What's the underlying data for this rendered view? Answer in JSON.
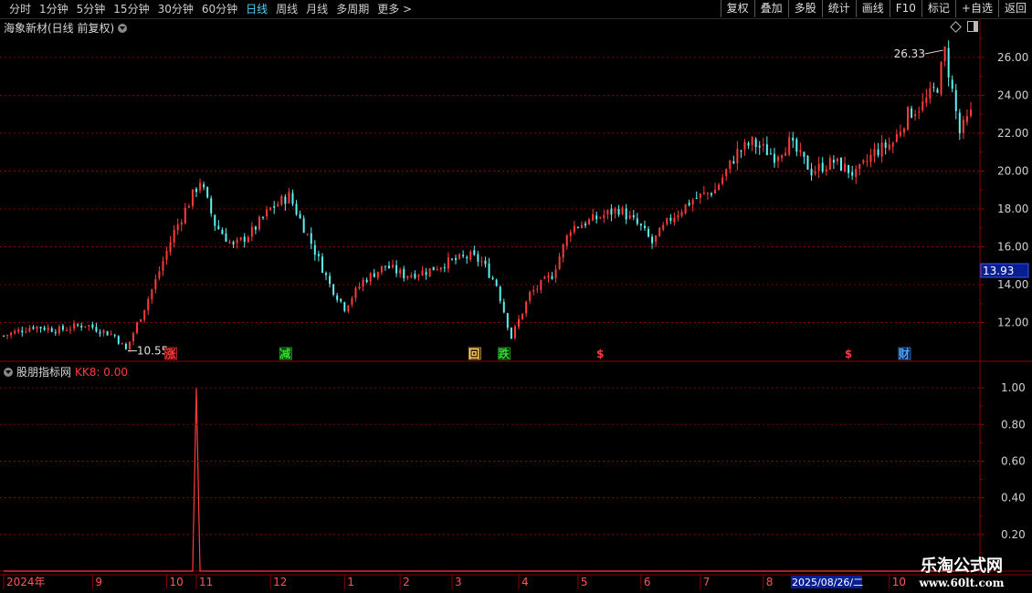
{
  "toolbar": {
    "periods": [
      "分时",
      "1分钟",
      "5分钟",
      "15分钟",
      "30分钟",
      "60分钟",
      "日线",
      "周线",
      "月线",
      "多周期",
      "更多 >"
    ],
    "active_period": "日线",
    "buttons": [
      "复权",
      "叠加",
      "多股",
      "统计",
      "画线",
      "F10",
      "标记",
      "+自选",
      "返回"
    ]
  },
  "main_panel": {
    "title": "海象新材(日线 前复权)",
    "current_price": "13.93",
    "high_label": "26.33",
    "low_label": "10.55",
    "markers": [
      {
        "day": 45,
        "text": "涨",
        "color": "#ff3b3b",
        "bg": "#3a0000"
      },
      {
        "day": 76,
        "text": "减",
        "color": "#33dd33",
        "bg": "#003300"
      },
      {
        "day": 127,
        "text": "回",
        "color": "#ffcc66",
        "bg": "#332200"
      },
      {
        "day": 135,
        "text": "跌",
        "color": "#33dd33",
        "bg": "#002200"
      },
      {
        "day": 161,
        "text": "$",
        "color": "#ff3b3b",
        "bg": ""
      },
      {
        "day": 228,
        "text": "$",
        "color": "#ff3b3b",
        "bg": ""
      },
      {
        "day": 243,
        "text": "财",
        "color": "#4fa8ff",
        "bg": "#001a40"
      }
    ]
  },
  "indicator_panel": {
    "name": "股朋指标网",
    "value_text": "KK8: 0.00"
  },
  "time_axis": {
    "labels": [
      "2024年",
      "9",
      "10",
      "11",
      "12",
      "1",
      "2",
      "3",
      "4",
      "5",
      "6",
      "7",
      "8",
      "10"
    ],
    "cursor_date": "2025/08/26/二"
  },
  "colors": {
    "up": "#ff3b3b",
    "down": "#5ff2f2",
    "grid": "#8b0000",
    "axis": "#8b0000",
    "price_box": "#0a1f8f"
  },
  "chart_data": [
    {
      "type": "candlestick",
      "title": "海象新材(日线 前复权)",
      "y_ticks": [
        12.0,
        14.0,
        16.0,
        18.0,
        20.0,
        22.0,
        24.0,
        26.0
      ],
      "ylim": [
        10.0,
        27.2
      ],
      "x_labels": [
        "2024年",
        "9",
        "10",
        "11",
        "12",
        "1",
        "2",
        "3",
        "4",
        "5",
        "6",
        "7",
        "8",
        "10"
      ],
      "anchors": [
        [
          0,
          11.3
        ],
        [
          8,
          11.8
        ],
        [
          15,
          11.6
        ],
        [
          22,
          11.9
        ],
        [
          30,
          11.3
        ],
        [
          33,
          10.55
        ],
        [
          38,
          12.8
        ],
        [
          41,
          14.2
        ],
        [
          46,
          16.8
        ],
        [
          53,
          19.5
        ],
        [
          57,
          17.2
        ],
        [
          62,
          16.0
        ],
        [
          67,
          16.8
        ],
        [
          72,
          18.0
        ],
        [
          77,
          18.7
        ],
        [
          83,
          16.2
        ],
        [
          88,
          14.0
        ],
        [
          92,
          12.8
        ],
        [
          97,
          14.2
        ],
        [
          103,
          15.0
        ],
        [
          108,
          14.5
        ],
        [
          114,
          14.7
        ],
        [
          120,
          15.2
        ],
        [
          126,
          15.5
        ],
        [
          129,
          15.2
        ],
        [
          133,
          14.0
        ],
        [
          137,
          11.2
        ],
        [
          142,
          13.5
        ],
        [
          148,
          14.5
        ],
        [
          153,
          17.0
        ],
        [
          160,
          17.5
        ],
        [
          166,
          18.0
        ],
        [
          172,
          17.0
        ],
        [
          175,
          16.2
        ],
        [
          180,
          17.5
        ],
        [
          186,
          18.5
        ],
        [
          192,
          19.0
        ],
        [
          198,
          21.0
        ],
        [
          202,
          21.5
        ],
        [
          208,
          20.8
        ],
        [
          212,
          21.5
        ],
        [
          218,
          20.0
        ],
        [
          224,
          20.5
        ],
        [
          230,
          19.8
        ],
        [
          235,
          21.0
        ],
        [
          240,
          21.5
        ],
        [
          244,
          23.0
        ],
        [
          248,
          23.5
        ],
        [
          252,
          24.5
        ],
        [
          254,
          26.33
        ],
        [
          256,
          24.2
        ],
        [
          258,
          22.0
        ],
        [
          261,
          23.0
        ]
      ],
      "count": 262,
      "seed": 7
    },
    {
      "type": "line",
      "title": "股朋指标网 KK8",
      "y_ticks": [
        0.2,
        0.4,
        0.6,
        0.8,
        1.0
      ],
      "ylim": [
        0,
        1.1
      ],
      "spikes": [
        {
          "day": 52,
          "value": 1.0
        }
      ],
      "value": "0.00"
    }
  ]
}
